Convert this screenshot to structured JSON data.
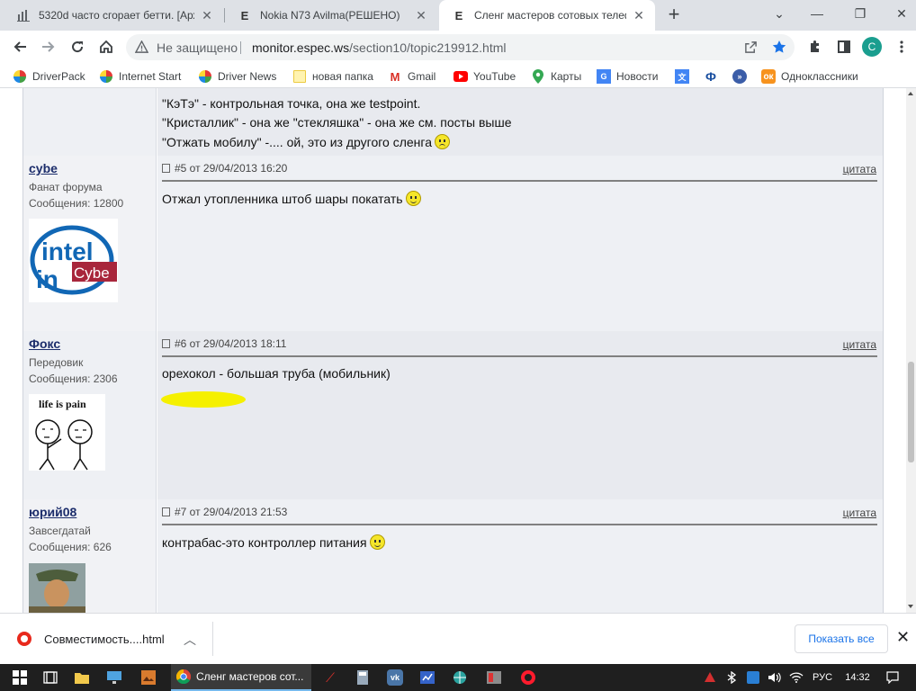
{
  "browser": {
    "tabs": [
      {
        "title": "5320d часто сгорает бетти. [Арх",
        "icon": "chart-icon"
      },
      {
        "title": "Nokia N73 Avilma(РЕШЕНО)",
        "icon": "e-icon"
      },
      {
        "title": "Сленг мастеров сотовых телеф",
        "icon": "e-icon",
        "active": true
      }
    ],
    "new_tab": "+",
    "address": {
      "security_label": "Не защищено",
      "host": "monitor.espec.ws",
      "path": "/section10/topic219912.html"
    },
    "profile_initial": "С",
    "bookmarks": [
      "DriverPack",
      "Internet Start",
      "Driver News",
      "новая папка",
      "Gmail",
      "YouTube",
      "Карты",
      "Новости",
      "Одноклассники"
    ]
  },
  "prev_post_lines": [
    "\"КэТэ\" - контрольная точка, она же testpoint.",
    "\"Кристаллик\" - она же \"стекляшка\" - она же см. посты выше",
    "\"Отжать мобилу\" -.... ой, это из другого сленга"
  ],
  "posts": [
    {
      "username": "cybe",
      "rank": "Фанат форума",
      "messages": "Сообщения: 12800",
      "header": "#5 от 29/04/2013 16:20",
      "quote": "цитата",
      "body": "Отжал утопленника штоб шары покатать",
      "avatar": {
        "line1": "intel",
        "line2": "in",
        "badge": "Cybe"
      }
    },
    {
      "username": "Фокс",
      "rank": "Передовик",
      "messages": "Сообщения: 2306",
      "header": "#6 от 29/04/2013 18:11",
      "quote": "цитата",
      "body": "орехокол - большая труба (мобильник)",
      "avatar": {
        "caption": "life is pain"
      }
    },
    {
      "username": "юрий08",
      "rank": "Завсегдатай",
      "messages": "Сообщения: 626",
      "header": "#7 от 29/04/2013 21:53",
      "quote": "цитата",
      "body": "контрабас-это контроллер питания"
    }
  ],
  "downloads": {
    "file": "Совместимость....html",
    "show_all": "Показать все"
  },
  "taskbar": {
    "active_app": "Сленг мастеров сот...",
    "lang": "РУС",
    "time": "14:32"
  },
  "colors": {
    "accent": "#1a73e8",
    "username": "#1c2d6b"
  }
}
